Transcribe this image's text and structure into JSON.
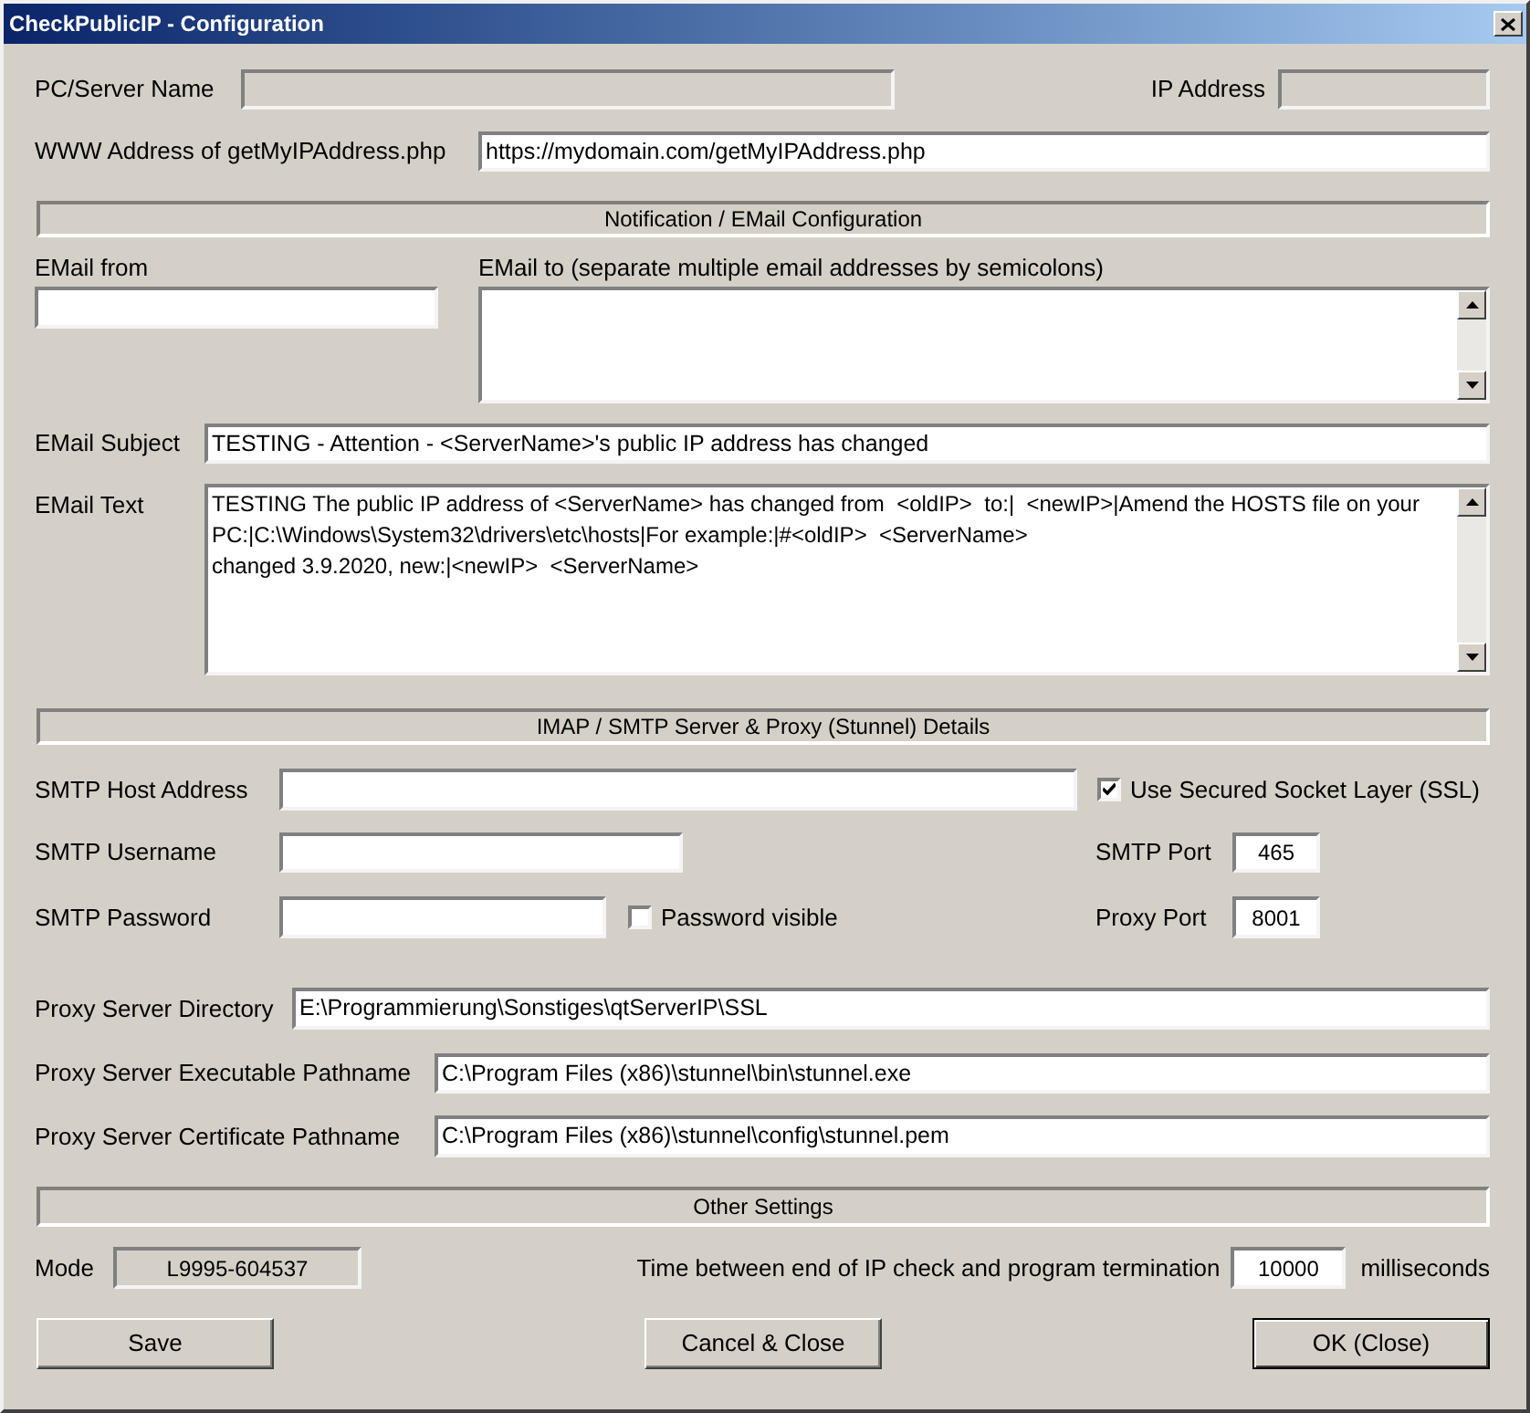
{
  "window": {
    "title": "CheckPublicIP - Configuration"
  },
  "server_name": {
    "label": "PC/Server Name"
  },
  "ip_address": {
    "label": "IP Address"
  },
  "url": {
    "label": "WWW Address of getMyIPAddress.php",
    "value": "https://mydomain.com/getMyIPAddress.php"
  },
  "notification": {
    "heading": "Notification / EMail Configuration",
    "from_label": "EMail from",
    "to_label": "EMail to (separate multiple email addresses by semicolons)",
    "subject_label": "EMail Subject",
    "subject": "TESTING - Attention - <ServerName>'s public IP address has changed",
    "text_label": "EMail Text",
    "text": "TESTING The public IP address of <ServerName> has changed from  <oldIP>  to:|  <newIP>|Amend the HOSTS file on your PC:|C:\\Windows\\System32\\drivers\\etc\\hosts|For example:|#<oldIP>  <ServerName>\nchanged 3.9.2020, new:|<newIP>  <ServerName>"
  },
  "server": {
    "heading": "IMAP / SMTP Server & Proxy (Stunnel) Details",
    "host_label": "SMTP Host Address",
    "ssl": {
      "label": "Use Secured Socket Layer (SSL)",
      "checked": true
    },
    "username_label": "SMTP Username",
    "port_label": "SMTP Port",
    "port": "465",
    "password_label": "SMTP Password",
    "password_visible": {
      "label": "Password visible",
      "checked": false
    },
    "proxy_port_label": "Proxy Port",
    "proxy_port": "8001",
    "proxy_dir_label": "Proxy Server Directory",
    "proxy_dir": "E:\\Programmierung\\Sonstiges\\qtServerIP\\SSL",
    "exe_label": "Proxy Server Executable Pathname",
    "exe": "C:\\Program Files (x86)\\stunnel\\bin\\stunnel.exe",
    "cert_label": "Proxy Server Certificate Pathname",
    "cert": "C:\\Program Files (x86)\\stunnel\\config\\stunnel.pem"
  },
  "other": {
    "heading": "Other Settings",
    "mode_label": "Mode",
    "mode": "L9995-604537",
    "time_label": "Time between end of IP check and program termination",
    "time": "10000",
    "time_unit": "milliseconds"
  },
  "buttons": [
    {
      "label": "Save",
      "default": false
    },
    {
      "label": "Cancel & Close",
      "default": false
    },
    {
      "label": "OK (Close)",
      "default": true
    }
  ]
}
